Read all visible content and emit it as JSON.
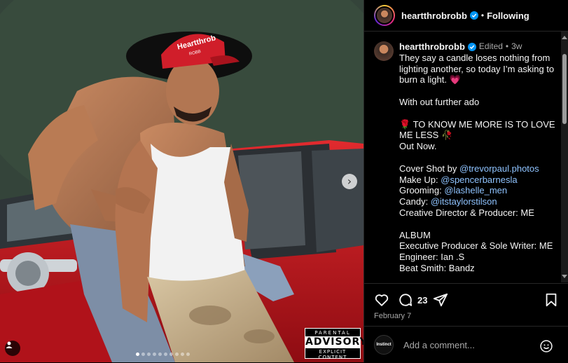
{
  "post": {
    "username": "heartthrobrobb",
    "separator": "•",
    "follow_status": "Following",
    "edited_label": "Edited",
    "age": "3w",
    "date": "February 7",
    "comment_count": "23",
    "comment_placeholder": "Add a comment...",
    "commenter_avatar_text": "Instinct",
    "cap_line_1": "They say a candle loses nothing from lighting another, so today I’m asking to burn a light. 💗",
    "cap_line_2": "With out further ado",
    "cap_line_3": "🌹 TO KNOW ME MORE IS TO LOVE ME LESS 🥀",
    "cap_line_4": "Out Now.",
    "credit_cover_label": "Cover Shot by ",
    "credit_cover_link": "@trevorpaul.photos",
    "credit_makeup_label": "Make Up: ",
    "credit_makeup_link": "@spencerbarnesla",
    "credit_grooming_label": "Grooming: ",
    "credit_grooming_link": "@lashelle_men",
    "credit_candy_label": "Candy: ",
    "credit_candy_link": "@itstaylorstilson",
    "credit_creative": "Creative Director & Producer: ME",
    "album_label": "ALBUM",
    "album_exec": "Executive Producer & Sole Writer: ME",
    "album_engineer": "Engineer: Ian .S",
    "album_beat": "Beat Smith: Bandz"
  },
  "media": {
    "cap_text_1": "Heartthrob",
    "cap_text_2": "ROBB",
    "advisory_line_1": "PARENTAL",
    "advisory_line_2": "ADVISORY",
    "advisory_line_3": "EXPLICIT CONTENT",
    "carousel_count": 10,
    "carousel_active": 1
  },
  "colors": {
    "accent_blue": "#0095f6",
    "car_red": "#c8141a",
    "cap_red": "#d01e2a"
  }
}
